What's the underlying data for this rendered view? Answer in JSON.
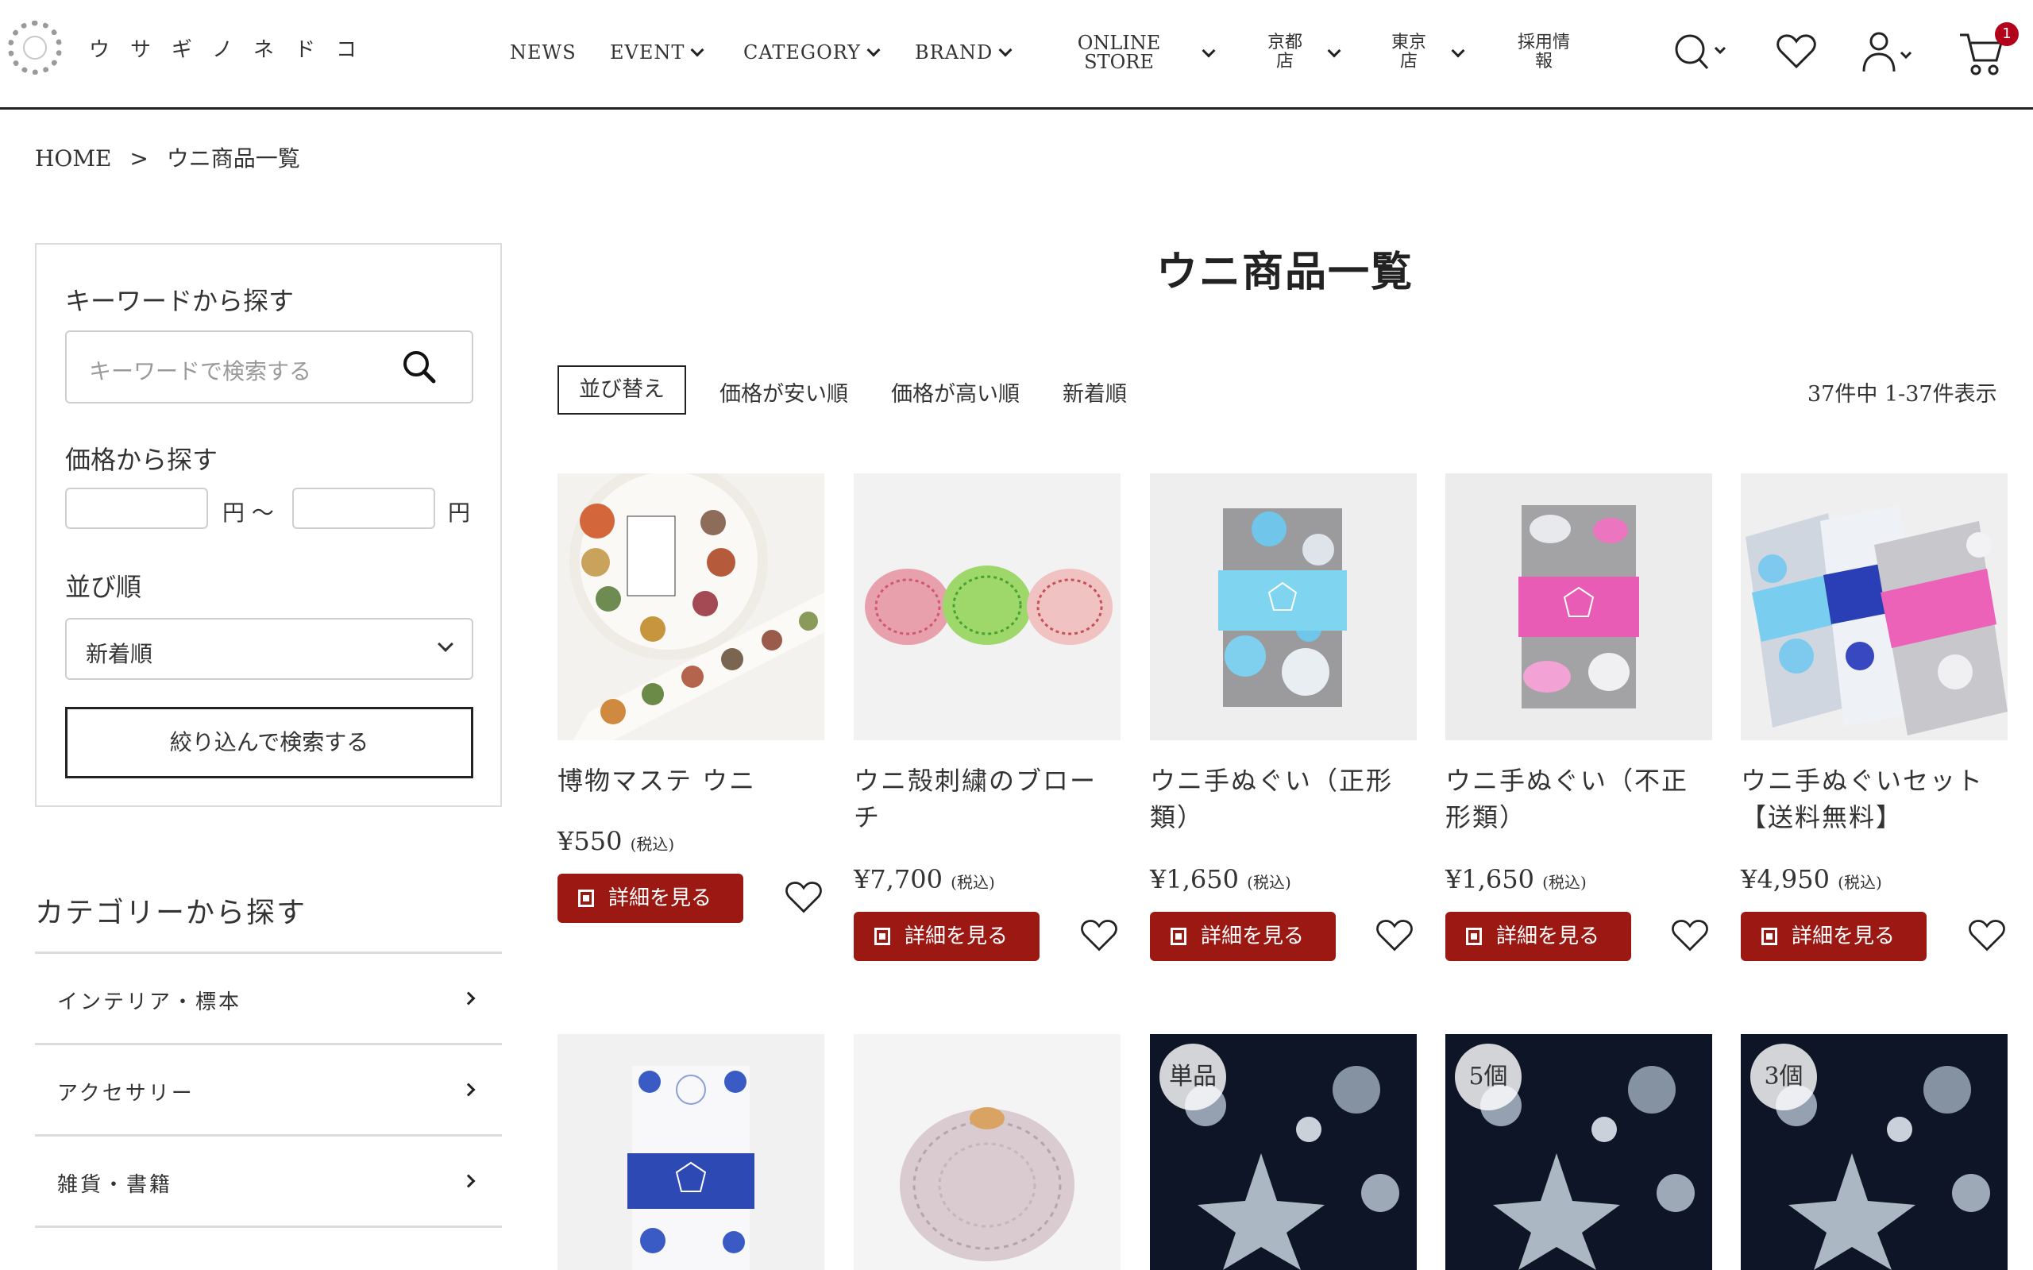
{
  "header": {
    "brand": "ウサギノネドコ",
    "nav": {
      "news": "NEWS",
      "event": "EVENT",
      "category": "CATEGORY",
      "brand": "BRAND",
      "online_store_line1": "ONLINE",
      "online_store_line2": "STORE",
      "kyoto_line1": "京都",
      "kyoto_line2": "店",
      "tokyo_line1": "東京",
      "tokyo_line2": "店",
      "recruit_line1": "採用情",
      "recruit_line2": "報"
    },
    "cart_count": "1",
    "accent_color": "#b3001b"
  },
  "breadcrumb": {
    "home": "HOME",
    "separator": ">",
    "current": "ウニ商品一覧"
  },
  "sidebar": {
    "keyword_heading": "キーワードから探す",
    "keyword_placeholder": "キーワードで検索する",
    "price_heading": "価格から探す",
    "price_from_suffix": "円 〜",
    "price_to_suffix": "円",
    "order_heading": "並び順",
    "order_value": "新着順",
    "filter_button": "絞り込んで検索する",
    "category_heading": "カテゴリーから探す",
    "categories": [
      {
        "label": "インテリア・標本"
      },
      {
        "label": "アクセサリー"
      },
      {
        "label": "雑貨・書籍"
      }
    ]
  },
  "main": {
    "title": "ウニ商品一覧",
    "sort_label": "並び替え",
    "sort_options": [
      "価格が安い順",
      "価格が高い順",
      "新着順"
    ],
    "result_count": "37件中 1-37件表示",
    "detail_button_label": "詳細を見る",
    "button_color": "#9c1812",
    "products": [
      {
        "name": "博物マステ ウニ",
        "price": "¥550",
        "tax": "(税込)"
      },
      {
        "name": "ウニ殻刺繍のブローチ",
        "price": "¥7,700",
        "tax": "(税込)"
      },
      {
        "name": "ウニ手ぬぐい（正形類）",
        "price": "¥1,650",
        "tax": "(税込)"
      },
      {
        "name": "ウニ手ぬぐい（不正形類）",
        "price": "¥1,650",
        "tax": "(税込)"
      },
      {
        "name": "ウニ手ぬぐいセット【送料無料】",
        "price": "¥4,950",
        "tax": "(税込)"
      }
    ],
    "second_row_badges": [
      "単品",
      "5個",
      "3個"
    ]
  }
}
